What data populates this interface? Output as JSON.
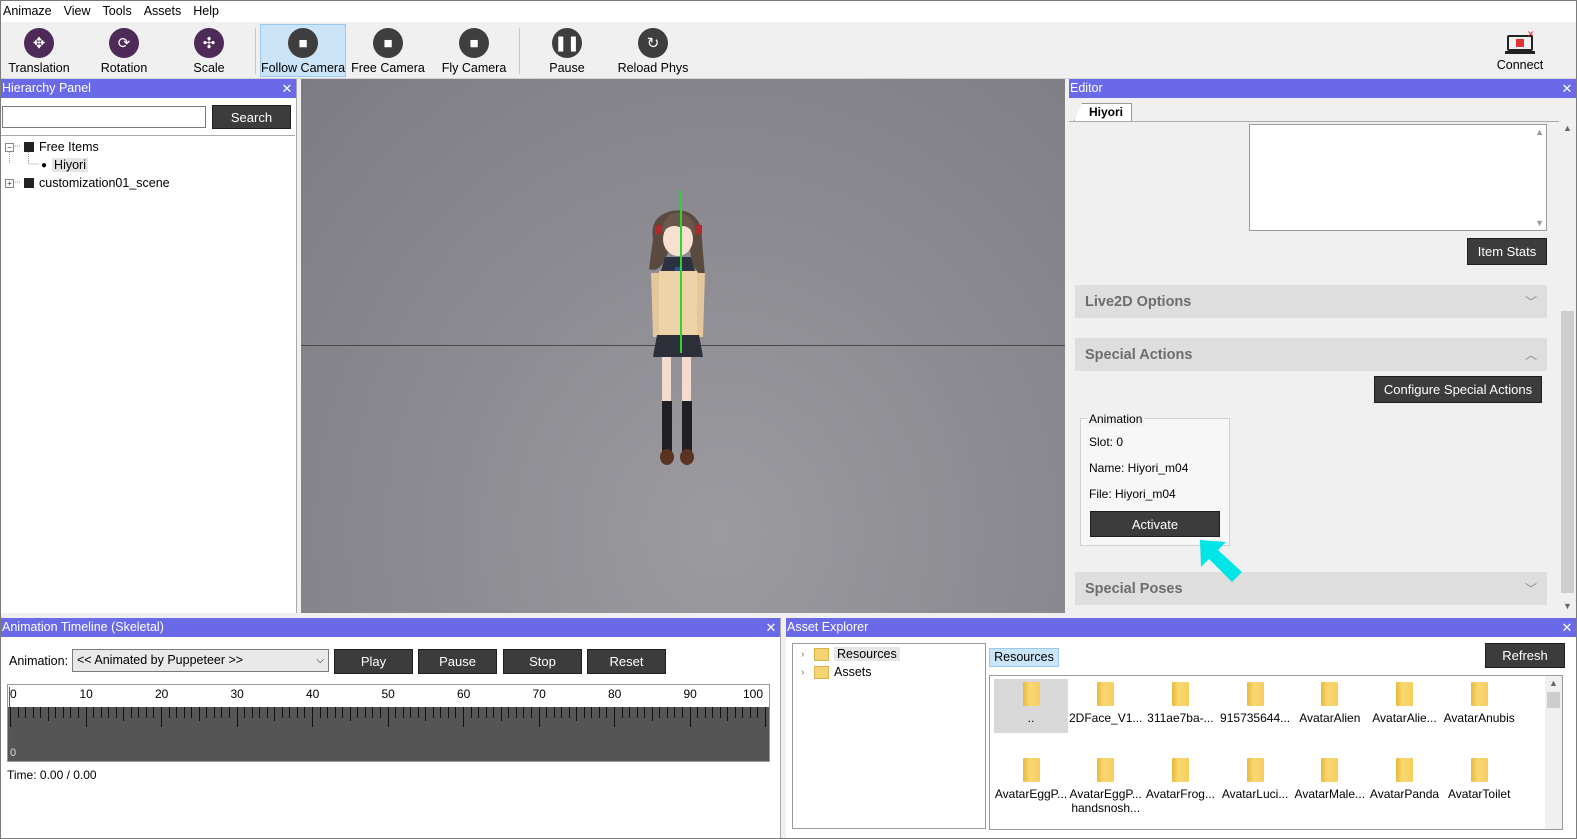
{
  "menu": [
    "Animaze",
    "View",
    "Tools",
    "Assets",
    "Help"
  ],
  "toolbar": {
    "translation": "Translation",
    "rotation": "Rotation",
    "scale": "Scale",
    "follow_camera": "Follow Camera",
    "free_camera": "Free Camera",
    "fly_camera": "Fly Camera",
    "pause": "Pause",
    "reload_phys": "Reload Phys",
    "connect": "Connect",
    "active_tool": "Follow Camera"
  },
  "hierarchy": {
    "title": "Hierarchy Panel",
    "search_value": "",
    "search_label": "Search",
    "nodes": [
      "Free Items",
      "Hiyori",
      "customization01_scene"
    ]
  },
  "editor": {
    "title": "Editor",
    "tab": "Hiyori",
    "item_stats": "Item Stats",
    "live2d_options": "Live2D Options",
    "special_actions": "Special Actions",
    "configure_special_actions": "Configure Special Actions",
    "animation_group": "Animation",
    "slot": "Slot: 0",
    "name": "Name: Hiyori_m04",
    "file": "File: Hiyori_m04",
    "activate": "Activate",
    "special_poses": "Special Poses"
  },
  "timeline": {
    "title": "Animation Timeline (Skeletal)",
    "animation_label": "Animation:",
    "animation_value": "<< Animated by Puppeteer >>",
    "play": "Play",
    "pause": "Pause",
    "stop": "Stop",
    "reset": "Reset",
    "ticks": [
      "0",
      "10",
      "20",
      "30",
      "40",
      "50",
      "60",
      "70",
      "80",
      "90",
      "100"
    ],
    "time": "Time: 0.00 / 0.00"
  },
  "assets": {
    "title": "Asset Explorer",
    "tree": [
      "Resources",
      "Assets"
    ],
    "tab": "Resources",
    "refresh": "Refresh",
    "items": [
      "..",
      "2DFace_V1...",
      "311ae7ba-...",
      "915735644...",
      "AvatarAlien",
      "AvatarAlie...",
      "AvatarAnubis",
      "AvatarEggP...",
      "AvatarEggP...",
      "AvatarFrog...",
      "AvatarLuci...",
      "AvatarMale...",
      "AvatarPanda",
      "AvatarToilet"
    ],
    "item_second_line": "handsnosh..."
  },
  "colors": {
    "panel_title": "#6a6ae8",
    "dark_button": "#3c3c3c",
    "cursor_arrow": "#00e5e5"
  }
}
